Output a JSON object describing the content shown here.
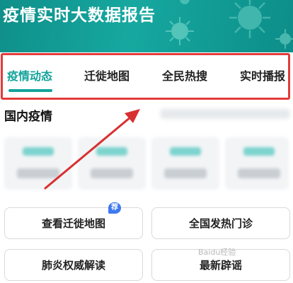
{
  "header": {
    "title": "疫情实时大数据报告"
  },
  "tabs": [
    {
      "label": "疫情动态",
      "active": true
    },
    {
      "label": "迁徙地图",
      "active": false
    },
    {
      "label": "全民热搜",
      "active": false
    },
    {
      "label": "实时播报",
      "active": false
    }
  ],
  "section": {
    "title": "国内疫情"
  },
  "buttons": {
    "migration_map": "查看迁徙地图",
    "fever_clinic": "全国发热门诊",
    "pneumonia_explain": "肺炎权威解读",
    "latest_rumor": "最新辟谣"
  },
  "badge": {
    "recommend": "荐"
  },
  "watermark": {
    "text": "Baidu经验"
  },
  "colors": {
    "accent": "#13a39b",
    "highlight": "#e43b3b",
    "arrow": "#d83030",
    "badge": "#3f78f0"
  }
}
